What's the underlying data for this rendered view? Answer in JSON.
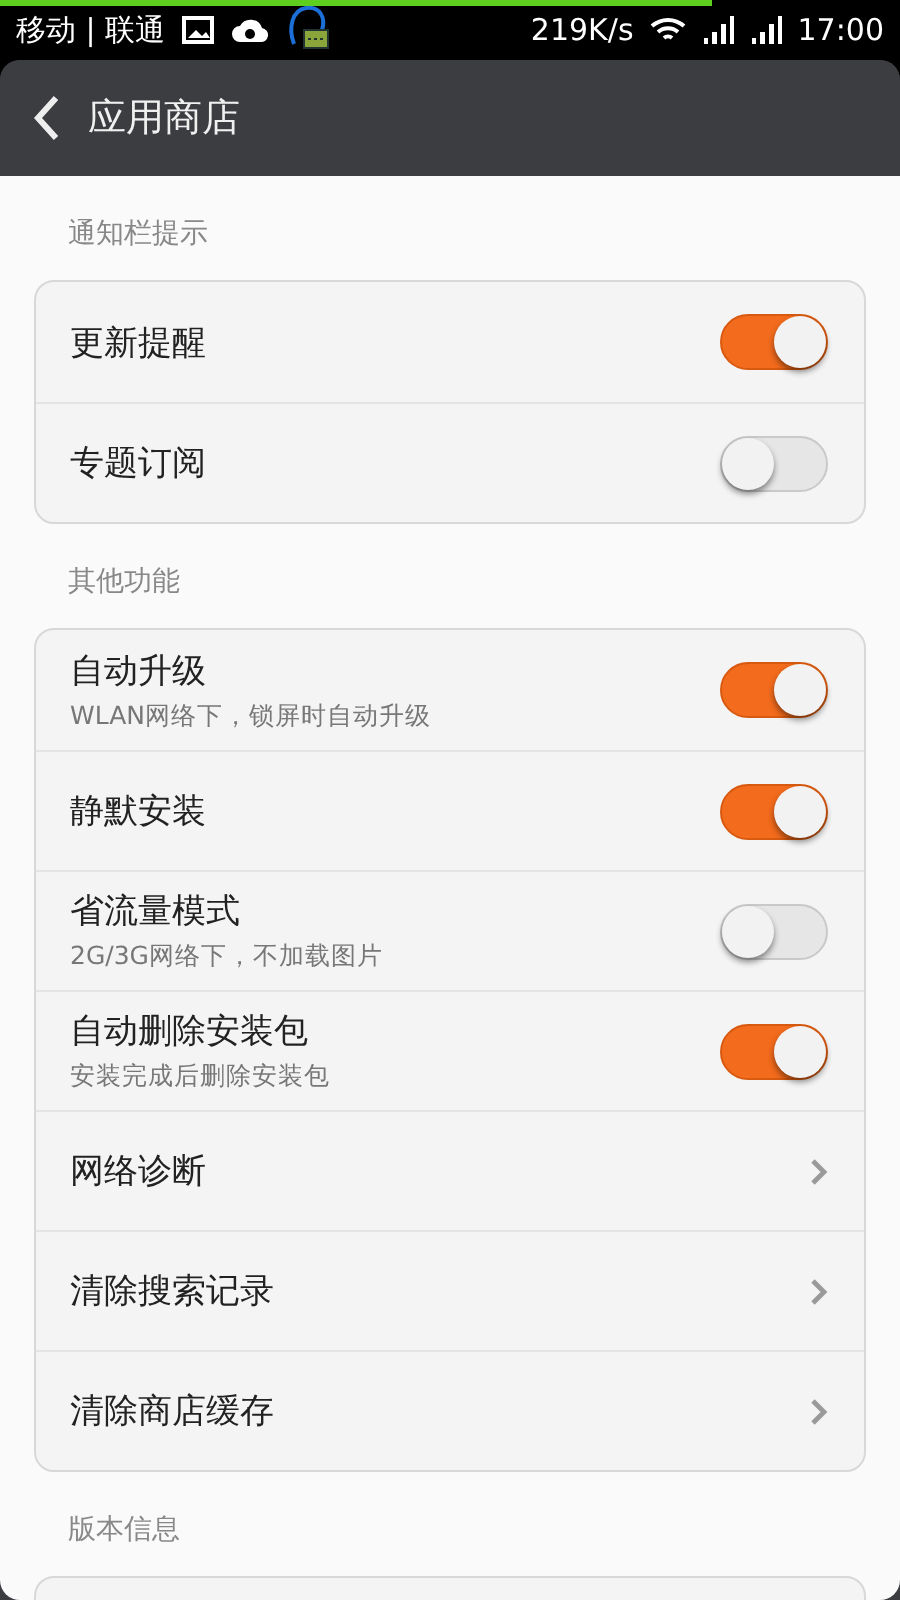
{
  "status_bar": {
    "carriers": "移动 | 联通",
    "speed": "219K/s",
    "time": "17:00",
    "progress": {
      "level": 0.79
    }
  },
  "header": {
    "title": "应用商店"
  },
  "sections": [
    {
      "title": "通知栏提示",
      "rows": [
        {
          "kind": "toggle",
          "label": "更新提醒",
          "on": true
        },
        {
          "kind": "toggle",
          "label": "专题订阅",
          "on": false
        }
      ]
    },
    {
      "title": "其他功能",
      "rows": [
        {
          "kind": "toggle",
          "label": "自动升级",
          "subtitle": "WLAN网络下，锁屏时自动升级",
          "on": true
        },
        {
          "kind": "toggle",
          "label": "静默安装",
          "on": true
        },
        {
          "kind": "toggle",
          "label": "省流量模式",
          "subtitle": "2G/3G网络下，不加载图片",
          "on": false
        },
        {
          "kind": "toggle",
          "label": "自动删除安装包",
          "subtitle": "安装完成后删除安装包",
          "on": true
        },
        {
          "kind": "link",
          "label": "网络诊断"
        },
        {
          "kind": "link",
          "label": "清除搜索记录"
        },
        {
          "kind": "link",
          "label": "清除商店缓存"
        }
      ]
    },
    {
      "title": "版本信息"
    }
  ]
}
